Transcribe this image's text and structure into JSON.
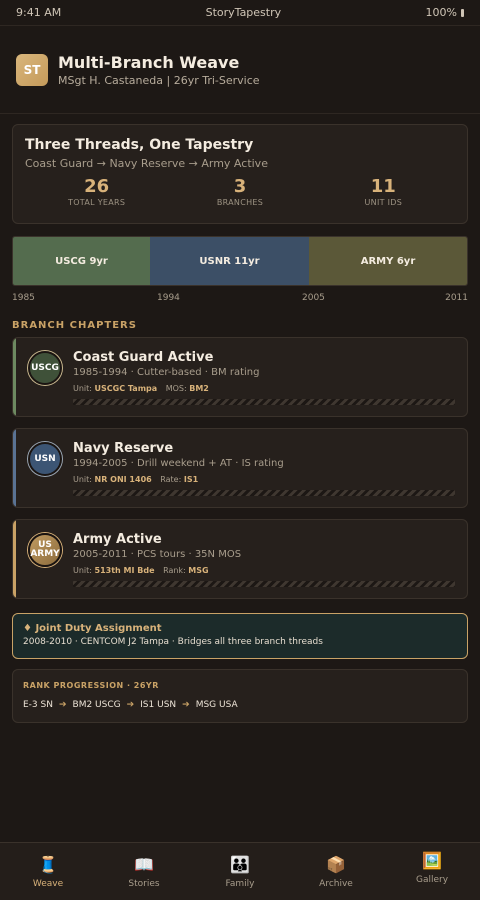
{
  "status": {
    "time": "9:41 AM",
    "app": "StoryTapestry",
    "battery": "100%"
  },
  "header": {
    "logo": "ST",
    "title": "Multi-Branch Weave",
    "subtitle": "MSgt H. Castaneda | 26yr Tri-Service"
  },
  "summary": {
    "title": "Three Threads, One Tapestry",
    "route": "Coast Guard → Navy Reserve → Army Active",
    "stats": [
      {
        "value": "26",
        "label": "TOTAL YEARS"
      },
      {
        "value": "3",
        "label": "BRANCHES"
      },
      {
        "value": "11",
        "label": "UNIT IDS"
      }
    ]
  },
  "timeline": {
    "segments": [
      {
        "label": "USCG 9yr",
        "color": "#546c4e"
      },
      {
        "label": "USNR 11yr",
        "color": "#3c4f66"
      },
      {
        "label": "ARMY 6yr",
        "color": "#5b5838"
      }
    ],
    "years": [
      "1985",
      "1994",
      "2005",
      "2011"
    ]
  },
  "chapters_label": "BRANCH CHAPTERS",
  "chapters": [
    {
      "badge": "USCG",
      "title": "Coast Guard Active",
      "meta": "1985-1994 · Cutter-based · BM rating",
      "unit_label": "Unit:",
      "unit": "USCGC Tampa",
      "rate_label": "MOS:",
      "rate": "BM2"
    },
    {
      "badge": "USN",
      "title": "Navy Reserve",
      "meta": "1994-2005 · Drill weekend + AT · IS rating",
      "unit_label": "Unit:",
      "unit": "NR ONI 1406",
      "rate_label": "Rate:",
      "rate": "IS1"
    },
    {
      "badge": "US ARMY",
      "title": "Army Active",
      "meta": "2005-2011 · PCS tours · 35N MOS",
      "unit_label": "Unit:",
      "unit": "513th MI Bde",
      "rate_label": "Rank:",
      "rate": "MSG"
    }
  ],
  "joint": {
    "title": "♦ Joint Duty Assignment",
    "text": "2008-2010 · CENTCOM J2 Tampa · Bridges all three branch threads"
  },
  "rank": {
    "title": "RANK PROGRESSION · 26YR",
    "steps": [
      "E-3 SN",
      "BM2 USCG",
      "IS1 USN",
      "MSG USA"
    ],
    "arrow": "➔"
  },
  "tabs": [
    {
      "icon": "🧵",
      "label": "Weave"
    },
    {
      "icon": "📖",
      "label": "Stories"
    },
    {
      "icon": "👪",
      "label": "Family"
    },
    {
      "icon": "📦",
      "label": "Archive"
    },
    {
      "icon": "🖼️",
      "label": "Gallery"
    }
  ],
  "accent_color": "#d8b27a"
}
